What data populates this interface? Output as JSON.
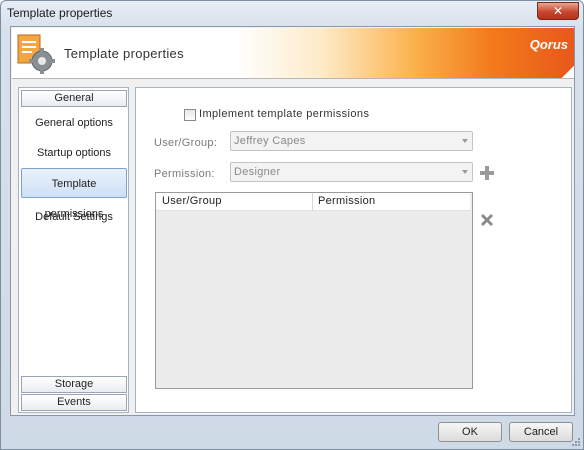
{
  "window": {
    "title": "Template properties",
    "close_label": "✕"
  },
  "header": {
    "title": "Template properties",
    "brand": "Qorus",
    "icon": "document-gear-icon"
  },
  "sidebar": {
    "groups": {
      "general": "General",
      "storage": "Storage",
      "events": "Events"
    },
    "items": [
      {
        "label": "General options"
      },
      {
        "label": "Startup options"
      },
      {
        "label": "Template permissions",
        "selected": true
      },
      {
        "label": "Default Settings"
      }
    ]
  },
  "permissions": {
    "implement_label": "Implement template permissions",
    "implement_checked": false,
    "user_group_label": "User/Group:",
    "user_group_value": "Jeffrey Capes",
    "permission_label": "Permission:",
    "permission_value": "Designer",
    "add_icon": "plus-icon",
    "remove_icon": "x-delete-icon",
    "grid": {
      "columns": [
        "User/Group",
        "Permission"
      ],
      "rows": []
    }
  },
  "footer": {
    "ok_label": "OK",
    "cancel_label": "Cancel"
  },
  "colors": {
    "accent_orange": "#f37b1c",
    "selection_blue": "#cde0f5"
  }
}
